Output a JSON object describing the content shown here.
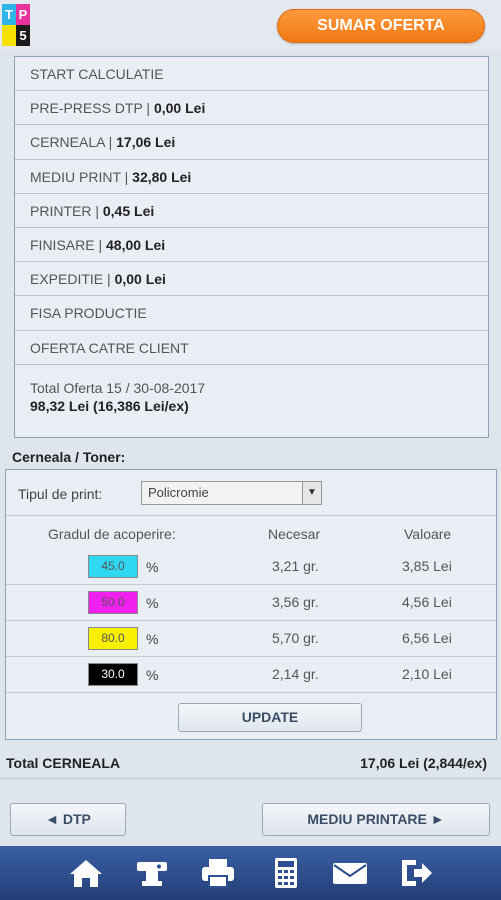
{
  "logo": {
    "letters": [
      "T",
      "P",
      "5"
    ]
  },
  "header": {
    "sumar_label": "SUMAR OFERTA"
  },
  "summary": {
    "items": [
      {
        "label": "START CALCULATIE",
        "value": ""
      },
      {
        "label": "PRE-PRESS DTP",
        "value": "0,00 Lei"
      },
      {
        "label": "CERNEALA",
        "value": "17,06 Lei"
      },
      {
        "label": "MEDIU PRINT",
        "value": "32,80 Lei"
      },
      {
        "label": "PRINTER",
        "value": "0,45 Lei"
      },
      {
        "label": "FINISARE",
        "value": "48,00 Lei"
      },
      {
        "label": "EXPEDITIE",
        "value": "0,00 Lei"
      },
      {
        "label": "FISA PRODUCTIE",
        "value": ""
      },
      {
        "label": "OFERTA CATRE CLIENT",
        "value": ""
      }
    ],
    "total_label": "Total Oferta 15 / 30-08-2017",
    "total_amount": "98,32 Lei (16,386 Lei/ex)"
  },
  "cerneala": {
    "title": "Cerneala / Toner:",
    "tip_label": "Tipul de print:",
    "tip_value": "Policromie",
    "col_coverage": "Gradul de acoperire:",
    "col_needed": "Necesar",
    "col_value": "Valoare",
    "pct_sign": "%",
    "inks": [
      {
        "color": "#2fd8f0",
        "text_color": "#555555",
        "coverage": "45.0",
        "needed": "3,21 gr.",
        "value": "3,85 Lei"
      },
      {
        "color": "#f020f0",
        "text_color": "#555555",
        "coverage": "50.0",
        "needed": "3,56 gr.",
        "value": "4,56 Lei"
      },
      {
        "color": "#f8f000",
        "text_color": "#555555",
        "coverage": "80.0",
        "needed": "5,70 gr.",
        "value": "6,56 Lei"
      },
      {
        "color": "#000000",
        "text_color": "#ffffff",
        "coverage": "30.0",
        "needed": "2,14 gr.",
        "value": "2,10 Lei"
      }
    ],
    "update_label": "UPDATE"
  },
  "totals": {
    "label": "Total CERNEALA",
    "value": "17,06 Lei (2,844/ex)"
  },
  "nav": {
    "prev_label": "◄ DTP",
    "next_label": "MEDIU PRINTARE ►"
  },
  "bottombar": {
    "icons": [
      "home-icon",
      "stamp-icon",
      "printer-icon",
      "calculator-icon",
      "mail-icon",
      "logout-icon"
    ]
  },
  "colors": {
    "logo": [
      "#2fb4e8",
      "#e8319a",
      "#f5e000",
      "#1a1a1a"
    ],
    "accent_orange": "#f07813",
    "bottom_bar": "#2d4f91"
  }
}
